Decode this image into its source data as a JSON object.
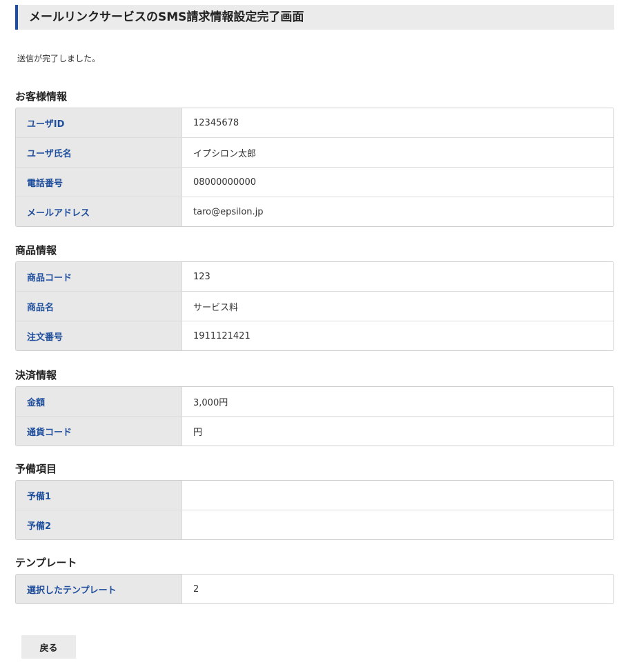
{
  "page": {
    "title": "メールリンクサービスのSMS請求情報設定完了画面",
    "message": "送信が完了しました。",
    "accent_color": "#1f4e9c"
  },
  "sections": {
    "customer": {
      "heading": "お客様情報",
      "rows": [
        {
          "label": "ユーザID",
          "value": "12345678"
        },
        {
          "label": "ユーザ氏名",
          "value": "イプシロン太郎"
        },
        {
          "label": "電話番号",
          "value": "08000000000"
        },
        {
          "label": "メールアドレス",
          "value": "taro@epsilon.jp"
        }
      ]
    },
    "product": {
      "heading": "商品情報",
      "rows": [
        {
          "label": "商品コード",
          "value": "123"
        },
        {
          "label": "商品名",
          "value": "サービス料"
        },
        {
          "label": "注文番号",
          "value": "1911121421"
        }
      ]
    },
    "payment": {
      "heading": "決済情報",
      "rows": [
        {
          "label": "金額",
          "value": "3,000円"
        },
        {
          "label": "通貨コード",
          "value": "円"
        }
      ]
    },
    "reserve": {
      "heading": "予備項目",
      "rows": [
        {
          "label": "予備1",
          "value": ""
        },
        {
          "label": "予備2",
          "value": ""
        }
      ]
    },
    "template": {
      "heading": "テンプレート",
      "rows": [
        {
          "label": "選択したテンプレート",
          "value": "2"
        }
      ]
    }
  },
  "actions": {
    "back_label": "戻る"
  }
}
